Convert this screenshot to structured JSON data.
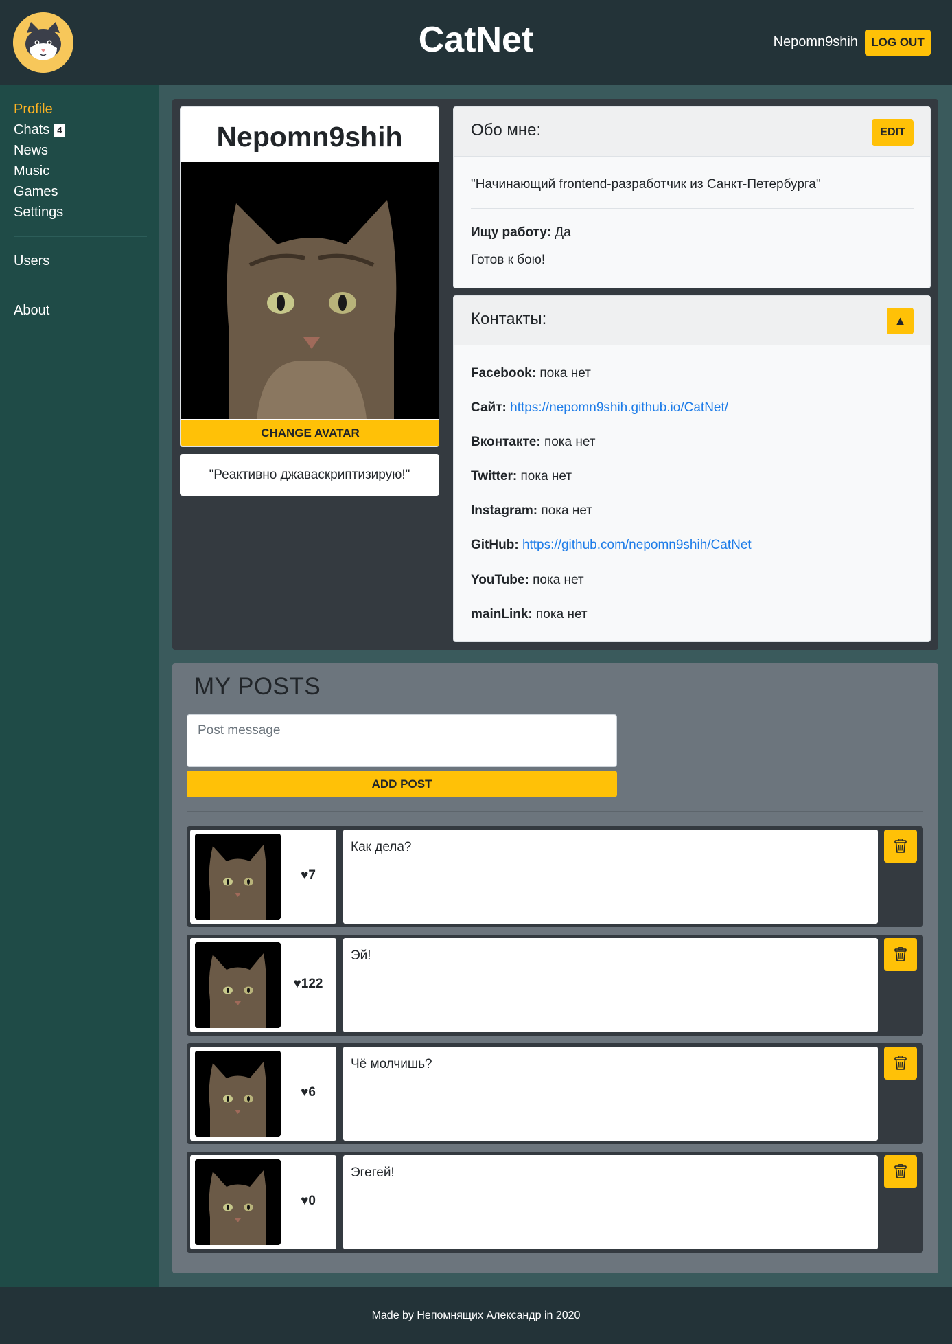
{
  "header": {
    "app_title": "CatNet",
    "user_name": "Nepomn9shih",
    "logout_label": "LOG OUT",
    "logo_icon": "cat-face-icon"
  },
  "sidebar": {
    "items": [
      {
        "label": "Profile",
        "active": true
      },
      {
        "label": "Chats",
        "badge": "4"
      },
      {
        "label": "News"
      },
      {
        "label": "Music"
      },
      {
        "label": "Games"
      },
      {
        "label": "Settings"
      },
      {
        "label": "Users"
      },
      {
        "label": "About"
      }
    ]
  },
  "profile": {
    "name": "Nepomn9shih",
    "change_avatar_label": "CHANGE AVATAR",
    "status": "\"Реактивно джаваскриптизирую!\""
  },
  "about": {
    "title": "Обо мне:",
    "edit_label": "EDIT",
    "quote": "\"Начинающий frontend-разработчик из Санкт-Петербурга\"",
    "job_label": "Ищу работу:",
    "job_value": "Да",
    "job_description": "Готов к бою!"
  },
  "contacts": {
    "title": "Контакты:",
    "toggle_icon": "▲",
    "items": [
      {
        "label": "Facebook:",
        "value": "пока нет",
        "link": false
      },
      {
        "label": "Сайт:",
        "value": "https://nepomn9shih.github.io/CatNet/",
        "link": true
      },
      {
        "label": "Вконтакте:",
        "value": "пока нет",
        "link": false
      },
      {
        "label": "Twitter:",
        "value": "пока нет",
        "link": false
      },
      {
        "label": "Instagram:",
        "value": "пока нет",
        "link": false
      },
      {
        "label": "GitHub:",
        "value": "https://github.com/nepomn9shih/CatNet",
        "link": true
      },
      {
        "label": "YouTube:",
        "value": "пока нет",
        "link": false
      },
      {
        "label": "mainLink:",
        "value": "пока нет",
        "link": false
      }
    ]
  },
  "posts": {
    "title": "MY POSTS",
    "input_placeholder": "Post message",
    "add_post_label": "ADD POST",
    "items": [
      {
        "likes": "♥7",
        "text": "Как дела?"
      },
      {
        "likes": "♥122",
        "text": "Эй!"
      },
      {
        "likes": "♥6",
        "text": "Чё молчишь?"
      },
      {
        "likes": "♥0",
        "text": "Эгегей!"
      }
    ]
  },
  "footer": {
    "text": "Made by Непомнящих Александр in 2020"
  },
  "colors": {
    "accent": "#ffc107",
    "active_nav": "#ffb422",
    "header_bg": "#233338",
    "sidebar_bg": "#1f4b47",
    "link": "#1d7ce8"
  }
}
